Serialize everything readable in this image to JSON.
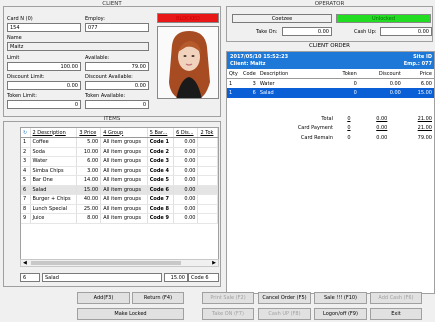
{
  "client": {
    "title": "CLIENT",
    "card_label": "Card N (0)",
    "card_value": "154",
    "employ_label": "Employ:",
    "employ_value": "077",
    "blocked": "BLOCKED",
    "name_label": "Name",
    "name_value": "Maitz",
    "limit_label": "Limit",
    "limit_value": "100.00",
    "available_label": "Available:",
    "available_value": "79.00",
    "discount_limit_label": "Discount Limit:",
    "discount_limit_value": "0.00",
    "discount_available_label": "Discount Available:",
    "discount_available_value": "0.00",
    "token_limit_label": "Token Limit:",
    "token_limit_value": "0",
    "token_available_label": "Token Available:",
    "token_available_value": "0"
  },
  "items": {
    "title": "ITEMS",
    "columns": [
      "2 Description",
      "3 Price",
      "4 Group",
      "5 Bar...",
      "6 Dis...",
      "2 Tok"
    ],
    "rows": [
      {
        "n": "1",
        "desc": "Coffee",
        "price": "5.00",
        "group": "All item groups",
        "bar": "Code 1",
        "dis": "0.00"
      },
      {
        "n": "2",
        "desc": "Soda",
        "price": "10.00",
        "group": "All item groups",
        "bar": "Code 2",
        "dis": "0.00"
      },
      {
        "n": "3",
        "desc": "Water",
        "price": "6.00",
        "group": "All item groups",
        "bar": "Code 3",
        "dis": "0.00"
      },
      {
        "n": "4",
        "desc": "Simba Chips",
        "price": "3.00",
        "group": "All item groups",
        "bar": "Code 4",
        "dis": "0.00"
      },
      {
        "n": "5",
        "desc": "Bar One",
        "price": "14.00",
        "group": "All item groups",
        "bar": "Code 5",
        "dis": "0.00"
      },
      {
        "n": "6",
        "desc": "Salad",
        "price": "15.00",
        "group": "All item groups",
        "bar": "Code 6",
        "dis": "0.00"
      },
      {
        "n": "7",
        "desc": "Burger + Chips",
        "price": "40.00",
        "group": "All item groups",
        "bar": "Code 7",
        "dis": "0.00"
      },
      {
        "n": "8",
        "desc": "Lunch Special",
        "price": "25.00",
        "group": "All item groups",
        "bar": "Code 8",
        "dis": "0.00"
      },
      {
        "n": "9",
        "desc": "Juice",
        "price": "8.00",
        "group": "All item groups",
        "bar": "Code 9",
        "dis": "0.00"
      }
    ],
    "footer_qty": "6",
    "footer_desc": "Salad",
    "footer_price": "15.00",
    "footer_code": "Code 6"
  },
  "operator": {
    "title": "OPERATOR",
    "name": "Coetzee",
    "status": "Unlocked",
    "take_on_label": "Take On:",
    "take_on_value": "0.00",
    "cash_up_label": "Cash Up:",
    "cash_up_value": "0.00"
  },
  "order": {
    "title": "CLIENT ORDER",
    "datetime": "2017/05/10 15:52:23",
    "site": "Site ID",
    "client": "Client: Maitz",
    "emp": "Emp.: 077",
    "columns": [
      "Qty",
      "Code",
      "Description",
      "Token",
      "Discount",
      "Price"
    ],
    "lines": [
      {
        "qty": "1",
        "code": "3",
        "desc": "Water",
        "token": "0",
        "discount": "0.00",
        "price": "6.00"
      },
      {
        "qty": "1",
        "code": "6",
        "desc": "Salad",
        "token": "0",
        "discount": "0.00",
        "price": "15.00"
      }
    ],
    "totals": [
      {
        "label": "Total",
        "token": "0",
        "discount": "0.00",
        "price": "21.00"
      },
      {
        "label": "Card Payment",
        "token": "0",
        "discount": "0.00",
        "price": "21.00"
      },
      {
        "label": "Card Remain",
        "token": "0",
        "discount": "0.00",
        "price": "79.00"
      }
    ]
  },
  "buttons": {
    "add": "Add(F3)",
    "return": "Return (F4)",
    "print_sale": "Print Sale (F2)",
    "cancel_order": "Cancel Order (F5)",
    "sale": "Sale !!! (F10)",
    "add_cash": "Add Cash (F6)",
    "make_locked": "Make Locked",
    "take_on": "Take ON (F7)",
    "cash_up": "Cash UP (F8)",
    "logon": "Logon/off (F9)",
    "exit": "Exit"
  },
  "colors": {
    "blocked": "#e81818",
    "unlocked": "#22dd22",
    "highlight": "#0a5fd6",
    "header": "#1e78d8"
  }
}
